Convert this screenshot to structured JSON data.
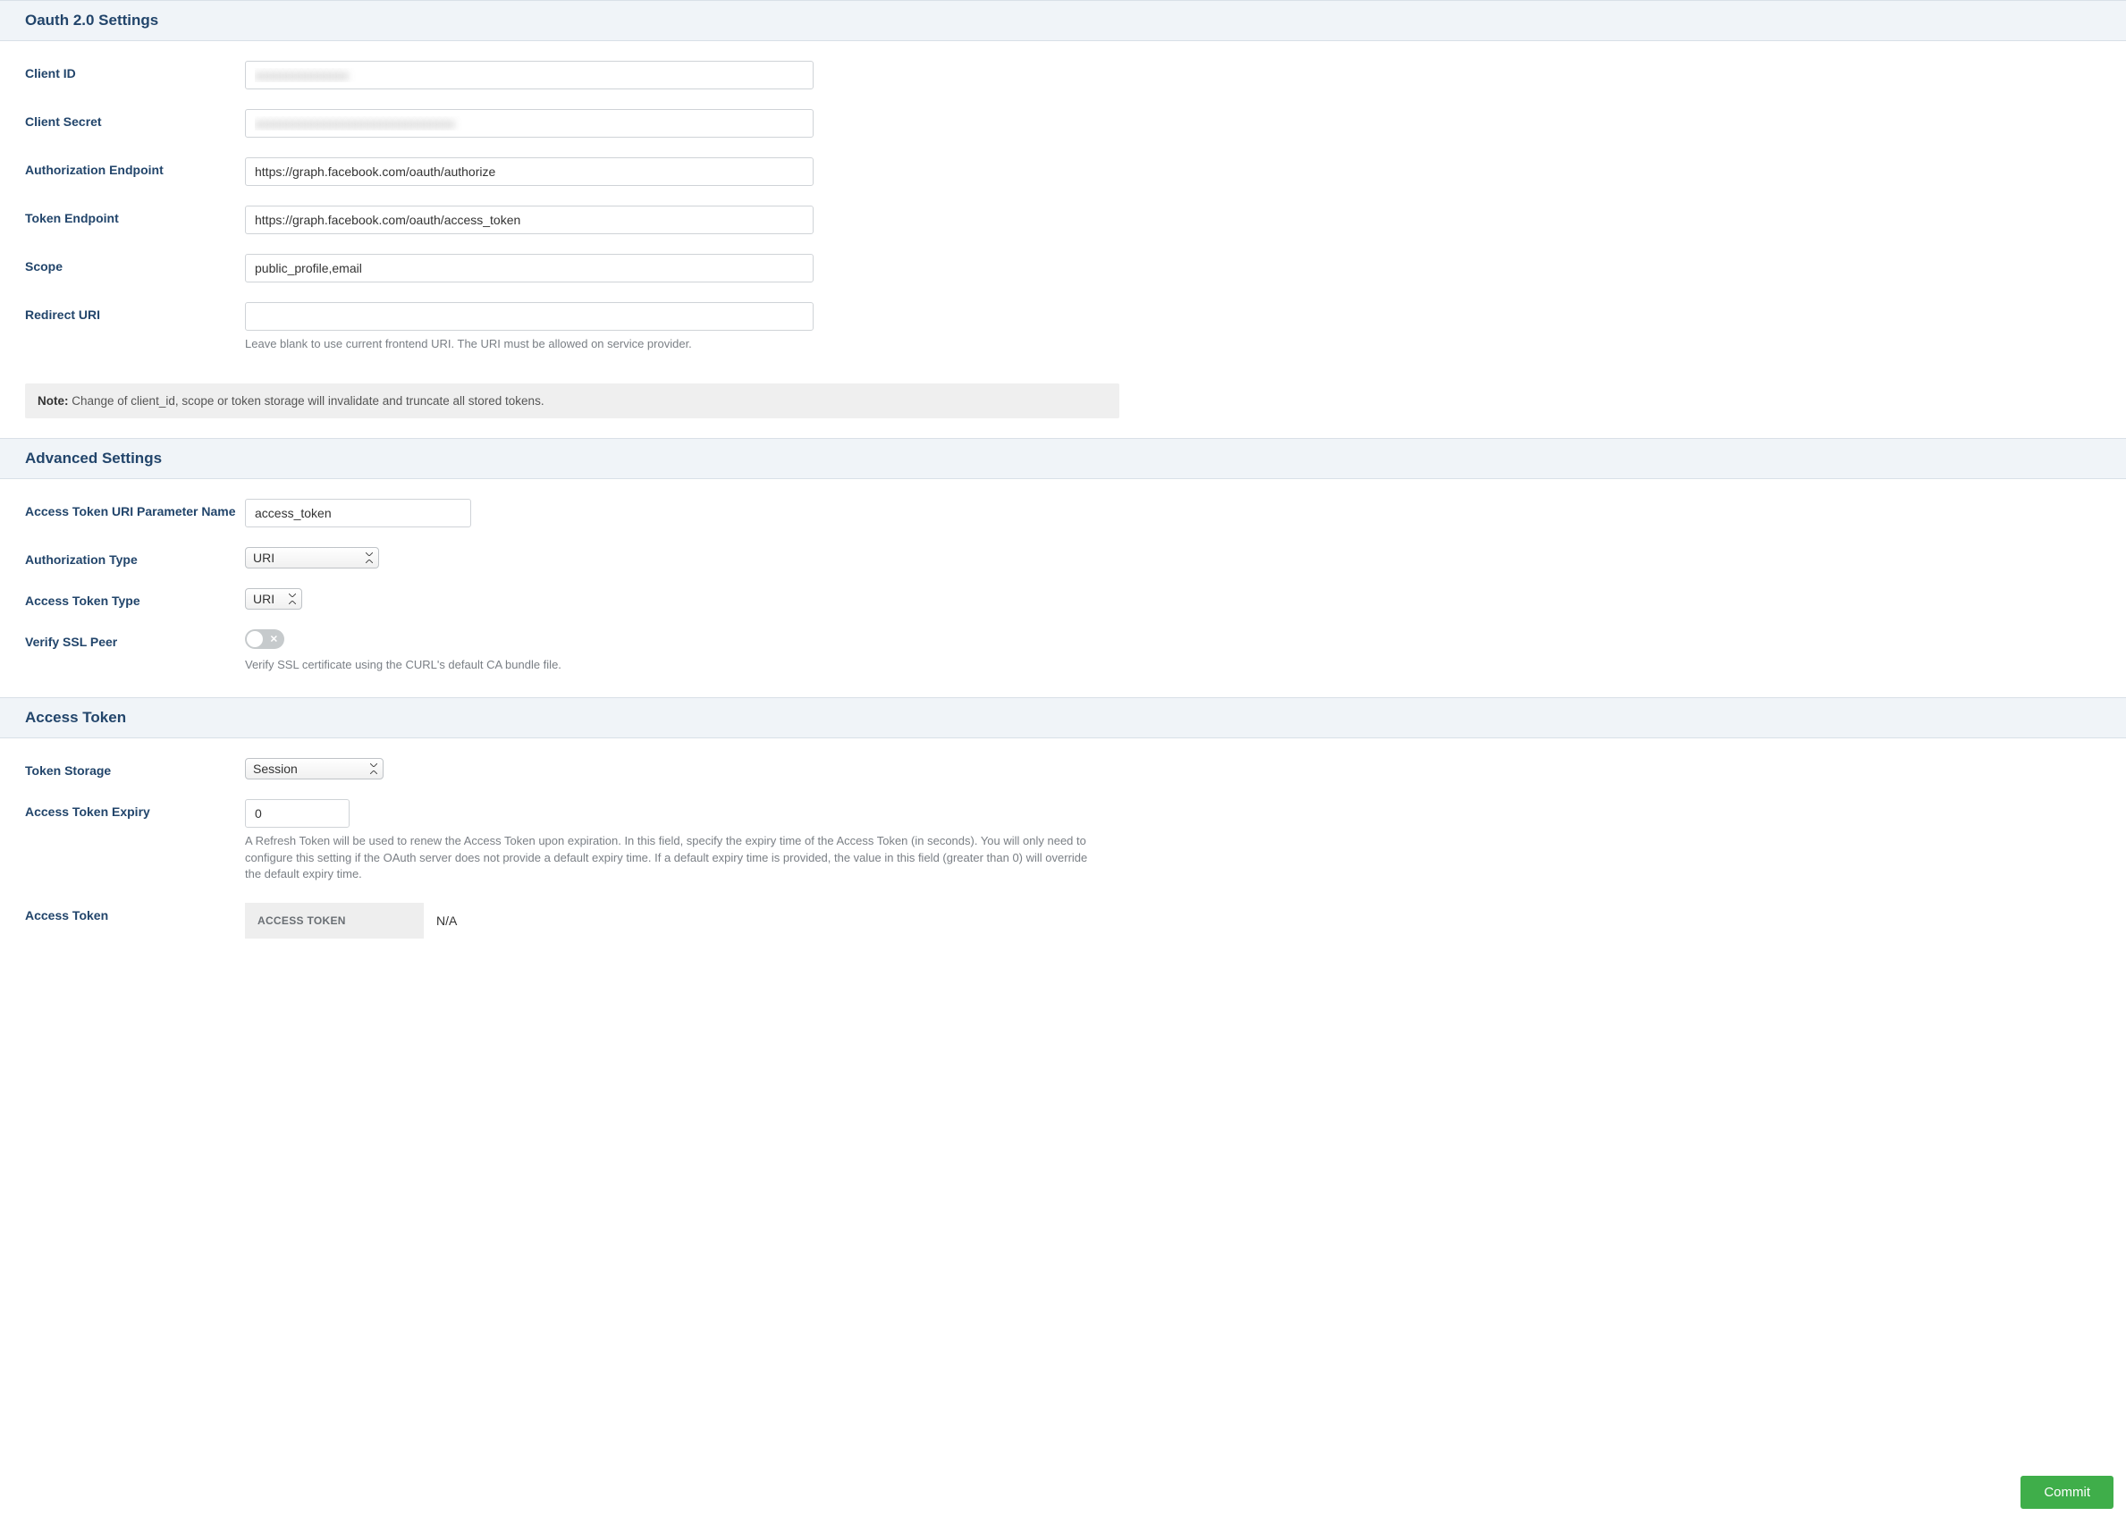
{
  "oauth": {
    "title": "Oauth 2.0 Settings",
    "client_id": {
      "label": "Client ID",
      "value": "xxxxxxxxxxxxxxx"
    },
    "client_secret": {
      "label": "Client Secret",
      "value": "xxxxxxxxxxxxxxxxxxxxxxxxxxxxxxxx"
    },
    "authorization_endpoint": {
      "label": "Authorization Endpoint",
      "value": "https://graph.facebook.com/oauth/authorize"
    },
    "token_endpoint": {
      "label": "Token Endpoint",
      "value": "https://graph.facebook.com/oauth/access_token"
    },
    "scope": {
      "label": "Scope",
      "value": "public_profile,email"
    },
    "redirect_uri": {
      "label": "Redirect URI",
      "value": "",
      "help": "Leave blank to use current frontend URI. The URI must be allowed on service provider."
    },
    "note_label": "Note:",
    "note_text": " Change of client_id, scope or token storage will invalidate and truncate all stored tokens."
  },
  "advanced": {
    "title": "Advanced Settings",
    "access_token_uri_param": {
      "label": "Access Token URI Parameter Name",
      "value": "access_token"
    },
    "authorization_type": {
      "label": "Authorization Type",
      "value": "URI"
    },
    "access_token_type": {
      "label": "Access Token Type",
      "value": "URI"
    },
    "verify_ssl_peer": {
      "label": "Verify SSL Peer",
      "value": false,
      "help": "Verify SSL certificate using the CURL's default CA bundle file."
    }
  },
  "access_token": {
    "title": "Access Token",
    "token_storage": {
      "label": "Token Storage",
      "value": "Session"
    },
    "access_token_expiry": {
      "label": "Access Token Expiry",
      "value": "0",
      "help": "A Refresh Token will be used to renew the Access Token upon expiration. In this field, specify the expiry time of the Access Token (in seconds). You will only need to configure this setting if the OAuth server does not provide a default expiry time. If a default expiry time is provided, the value in this field (greater than 0) will override the default expiry time."
    },
    "access_token_row": {
      "label": "Access Token",
      "header": "ACCESS TOKEN",
      "value": "N/A"
    }
  },
  "commit_label": "Commit"
}
